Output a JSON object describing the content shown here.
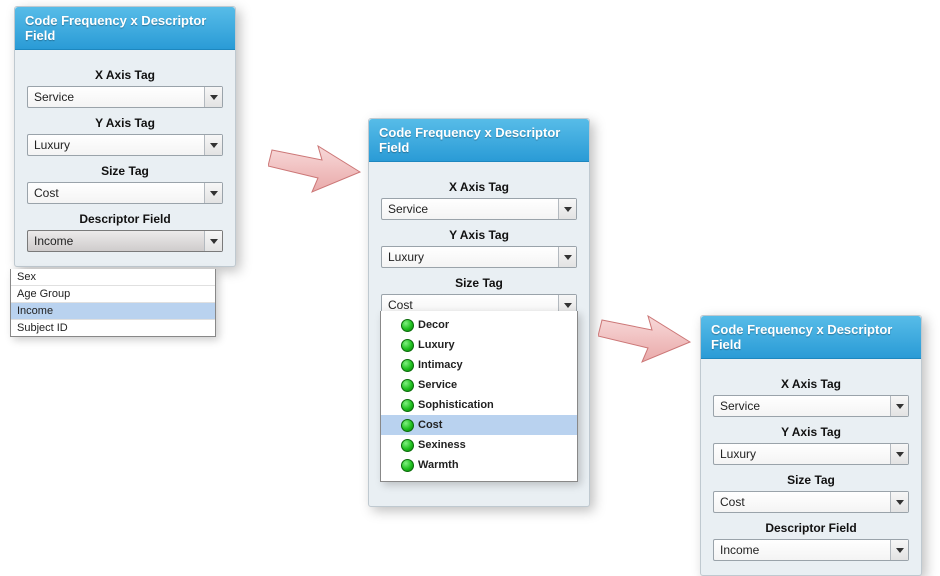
{
  "panel_title": "Code Frequency x Descriptor Field",
  "labels": {
    "x_axis": "X Axis Tag",
    "y_axis": "Y Axis Tag",
    "size": "Size Tag",
    "descriptor": "Descriptor Field"
  },
  "values": {
    "x_axis": "Service",
    "y_axis": "Luxury",
    "size": "Cost",
    "descriptor": "Income"
  },
  "descriptor_options": [
    {
      "label": "Sex",
      "selected": false
    },
    {
      "label": "Age Group",
      "selected": false
    },
    {
      "label": "Income",
      "selected": true
    },
    {
      "label": "Subject ID",
      "selected": false
    }
  ],
  "size_options": [
    {
      "label": "Decor",
      "selected": false
    },
    {
      "label": "Luxury",
      "selected": false
    },
    {
      "label": "Intimacy",
      "selected": false
    },
    {
      "label": "Service",
      "selected": false
    },
    {
      "label": "Sophistication",
      "selected": false
    },
    {
      "label": "Cost",
      "selected": true
    },
    {
      "label": "Sexiness",
      "selected": false
    },
    {
      "label": "Warmth",
      "selected": false
    }
  ]
}
